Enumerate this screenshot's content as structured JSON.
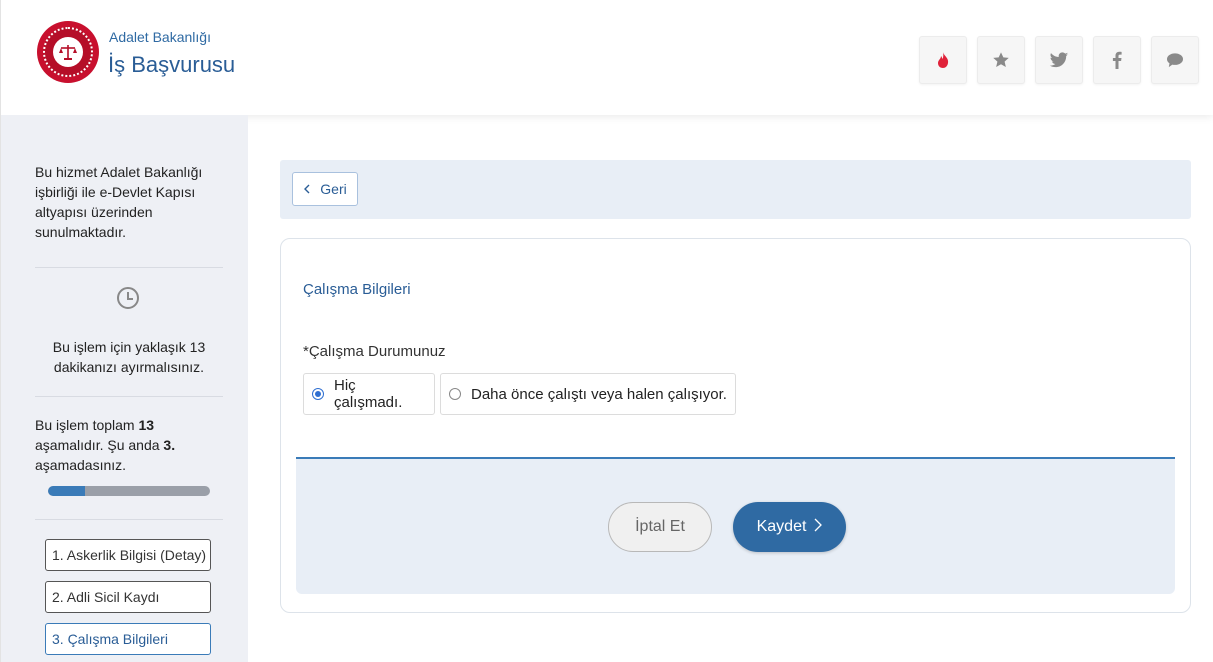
{
  "header": {
    "brand_sub": "Adalet Bakanlığı",
    "brand_title": "İş Başvurusu",
    "social_icons": [
      "fire-icon",
      "star-icon",
      "twitter-icon",
      "facebook-icon",
      "chat-icon"
    ],
    "colors": {
      "brand": "#2a5d96",
      "fire": "#e0223a",
      "social_gray": "#8a8a8a"
    }
  },
  "sidebar": {
    "intro": "Bu hizmet Adalet Bakanlığı işbirliği ile e-Devlet Kapısı altyapısı üzerinden sunulmaktadır.",
    "time_note": "Bu işlem için yaklaşık 13 dakikanızı ayırmalısınız.",
    "stage_prefix": "Bu işlem toplam ",
    "stage_total": "13",
    "stage_mid": " aşamalıdır. Şu anda ",
    "stage_current": "3.",
    "stage_suffix": " aşamadasınız.",
    "progress_fraction": 0.23,
    "steps": [
      {
        "label": "1. Askerlik Bilgisi (Detay)"
      },
      {
        "label": "2. Adli Sicil Kaydı"
      },
      {
        "label": "3. Çalışma Bilgileri"
      }
    ]
  },
  "main": {
    "back_label": "Geri",
    "section_title": "Çalışma Bilgileri",
    "field_label": "*Çalışma Durumunuz",
    "options": [
      {
        "label": "Hiç çalışmadı.",
        "selected": true
      },
      {
        "label": "Daha önce çalıştı veya halen çalışıyor.",
        "selected": false
      }
    ],
    "cancel_label": "İptal Et",
    "save_label": "Kaydet"
  }
}
